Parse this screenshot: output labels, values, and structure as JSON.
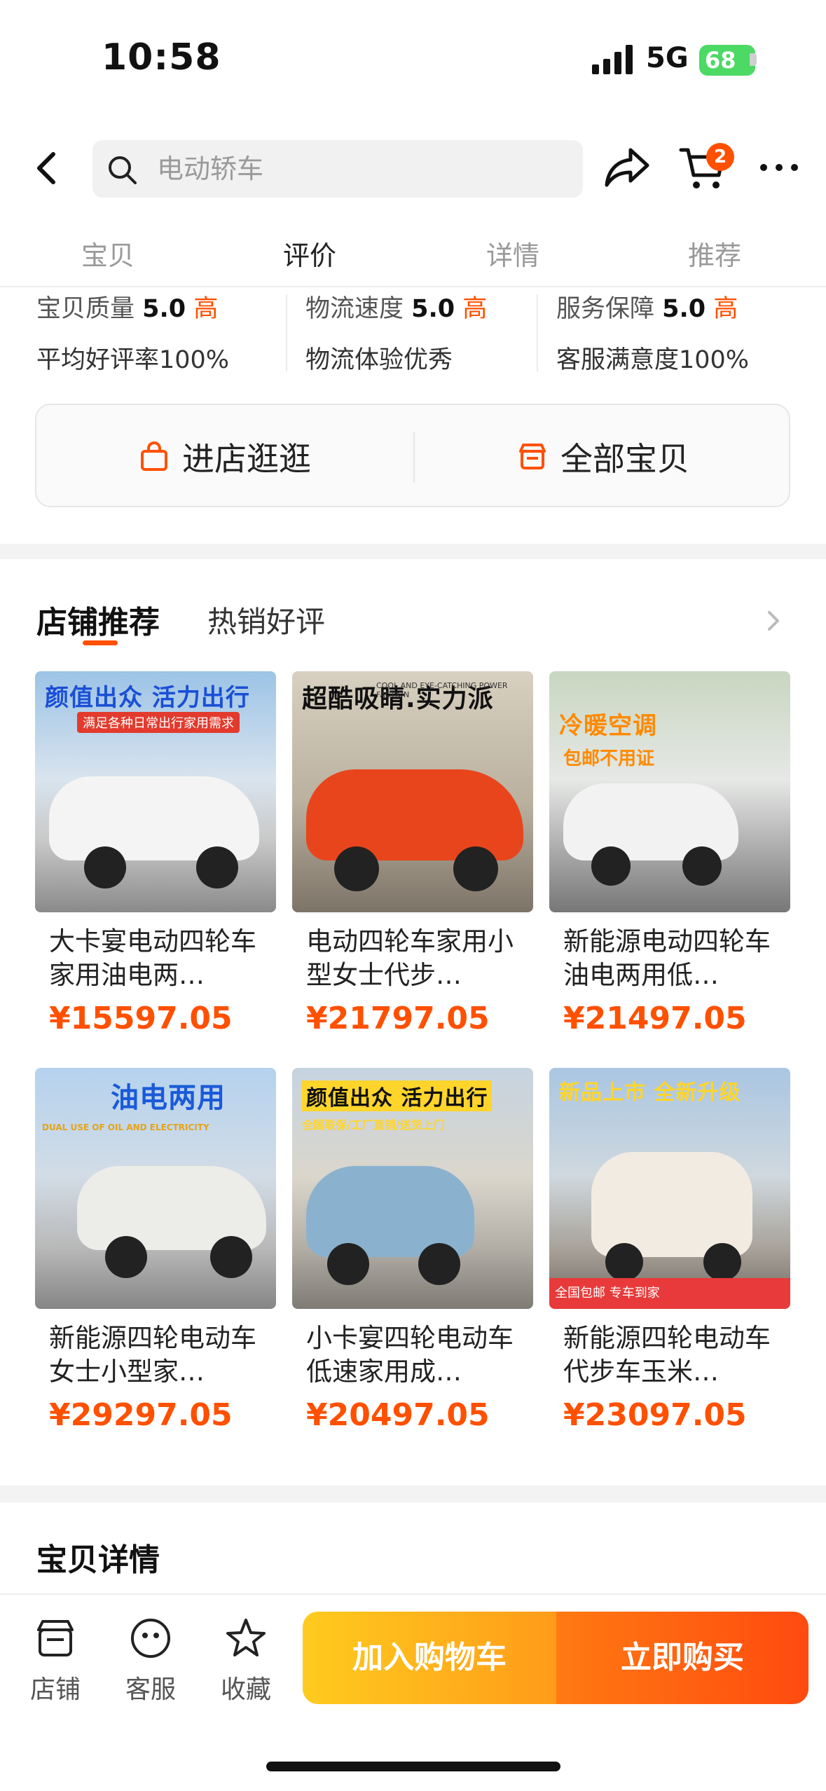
{
  "status": {
    "time": "10:58",
    "network": "5G",
    "battery": "68"
  },
  "search": {
    "placeholder": "电动轿车"
  },
  "cart": {
    "badge": "2"
  },
  "tabs": [
    "宝贝",
    "评价",
    "详情",
    "推荐"
  ],
  "ratings": [
    {
      "label": "宝贝质量",
      "score": "5.0",
      "level": "高",
      "summary": "平均好评率100%"
    },
    {
      "label": "物流速度",
      "score": "5.0",
      "level": "高",
      "summary": "物流体验优秀"
    },
    {
      "label": "服务保障",
      "score": "5.0",
      "level": "高",
      "summary": "客服满意度100%"
    }
  ],
  "store_buttons": {
    "visit": "进店逛逛",
    "all": "全部宝贝"
  },
  "recommend": {
    "tab_active": "店铺推荐",
    "tab_other": "热销好评"
  },
  "products": [
    {
      "title": "大卡宴电动四轮车家用油电两…",
      "price": "¥15597.05",
      "banner": "颜值出众 活力出行",
      "sub": "满足各种日常出行家用需求"
    },
    {
      "title": "电动四轮车家用小型女士代步…",
      "price": "¥21797.05",
      "banner": "超酷吸睛.实力派",
      "sub": "COOL AND EYE-CATCHING POWER FACTION"
    },
    {
      "title": "新能源电动四轮车油电两用低…",
      "price": "¥21497.05",
      "banner": "冷暖空调",
      "sub": "包邮不用证"
    },
    {
      "title": "新能源四轮电动车女士小型家…",
      "price": "¥29297.05",
      "banner": "油电两用",
      "sub": "DUAL USE OF OIL AND ELECTRICITY"
    },
    {
      "title": "小卡宴四轮电动车低速家用成…",
      "price": "¥20497.05",
      "banner": "颜值出众 活力出行",
      "sub": "全国联保/工厂直销/送货上门"
    },
    {
      "title": "新能源四轮电动车代步车玉米…",
      "price": "¥23097.05",
      "banner": "新品上市 全新升级",
      "sub": "全国包邮 专车到家"
    }
  ],
  "detail": {
    "title": "宝贝详情"
  },
  "bottom": {
    "shop": "店铺",
    "service": "客服",
    "fav": "收藏",
    "add_cart": "加入购物车",
    "buy_now": "立即购买"
  },
  "colors": {
    "accent": "#ff5000",
    "cart_btn": "#ffb21a",
    "buy_btn": "#ff5a10"
  },
  "icons": [
    "back-icon",
    "search-icon",
    "share-icon",
    "cart-icon",
    "more-icon",
    "bag-icon",
    "store-icon",
    "chevron-right-icon",
    "shop-icon",
    "service-icon",
    "star-icon"
  ]
}
